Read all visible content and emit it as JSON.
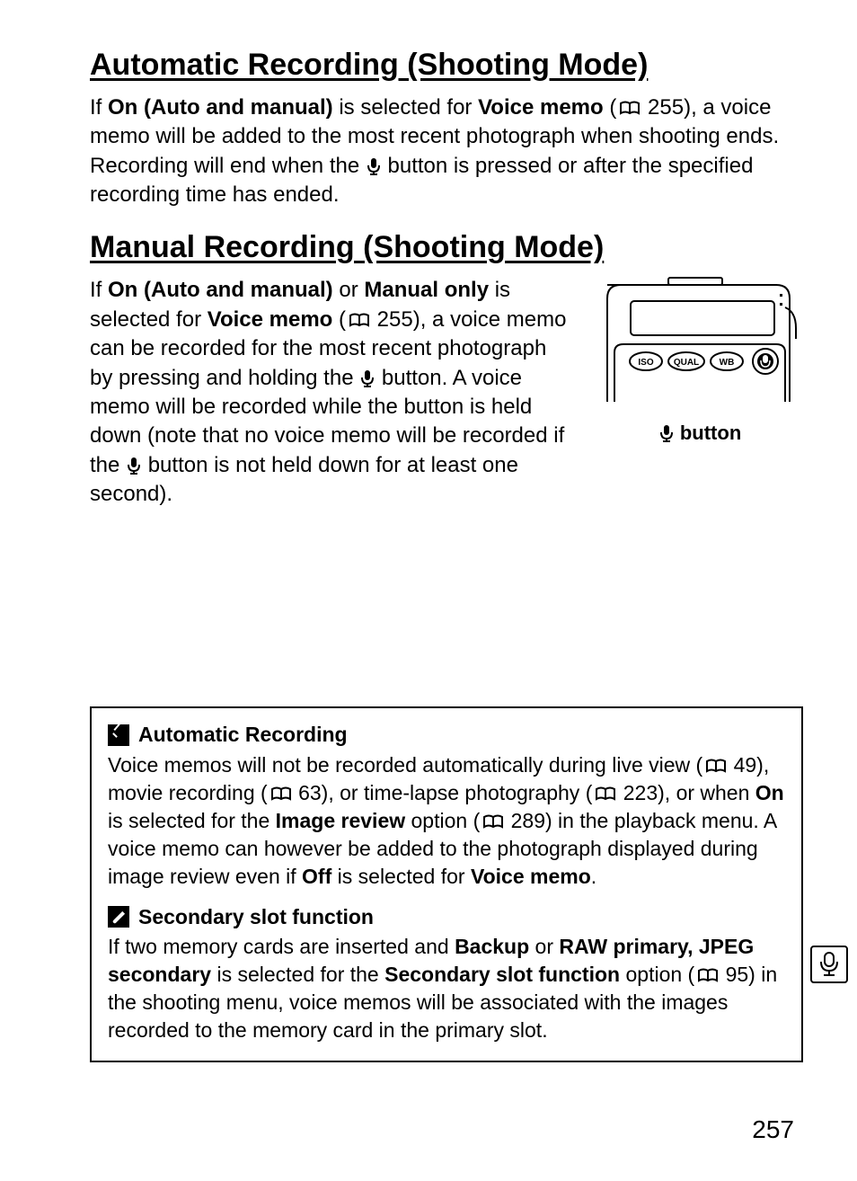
{
  "section1": {
    "heading": "Automatic Recording (Shooting Mode)",
    "p_a": "If ",
    "p_b": "On (Auto and manual)",
    "p_c": " is selected for ",
    "p_d": "Voice memo",
    "p_e": " (",
    "p_ref": " 255), a voice memo will be added to the most recent photograph when shooting ends.  Recording will end when the ",
    "p_f": " button is pressed or after the specified recording time has ended."
  },
  "section2": {
    "heading": "Manual Recording (Shooting Mode)",
    "p_a": "If ",
    "p_b": "On (Auto and manual)",
    "p_c": " or ",
    "p_d": "Manual only",
    "p_e": " is selected for ",
    "p_f": "Voice memo",
    "p_g": " (",
    "p_ref": " 255), a voice memo can be recorded for the most recent photograph by pressing and holding the ",
    "p_h": " button.  A voice memo will be recorded while the button is held down (note that no voice memo will be recorded if the ",
    "p_i": " button is not held down for at least one second).",
    "figcap": " button"
  },
  "note1": {
    "title": "Automatic Recording",
    "a": "Voice memos will not be recorded automatically during live view (",
    "r1": " 49), movie recording (",
    "r2": " 63), or time-lapse photography (",
    "r3": " 223), or when ",
    "b": "On",
    "c": " is selected for the ",
    "d": "Image review",
    "e": " option (",
    "r4": " 289) in the playback menu.  A voice memo can however be added to the photograph displayed during image review even if ",
    "f": "Off",
    "g": " is selected for ",
    "h": "Voice memo",
    "i": "."
  },
  "note2": {
    "title": "Secondary slot function",
    "a": "If two memory cards are inserted and ",
    "b": "Backup",
    "c": " or ",
    "d": "RAW primary, JPEG secondary",
    "e": " is selected for the ",
    "f": "Secondary slot function",
    "g": " option (",
    "r1": " 95) in the shooting menu, voice memos will be associated with the images recorded to the memory card in the primary slot."
  },
  "page": "257",
  "camera_labels": {
    "iso": "ISO",
    "qual": "QUAL",
    "wb": "WB"
  }
}
